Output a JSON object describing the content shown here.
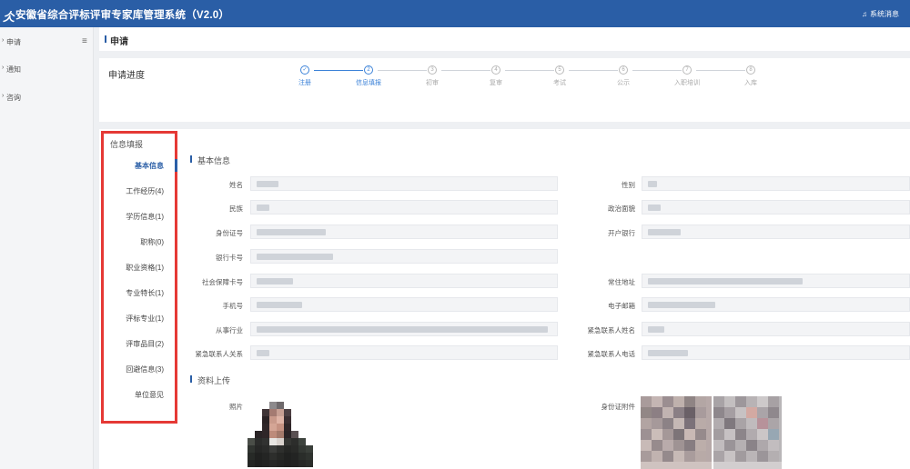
{
  "header": {
    "logo_glyph": "仌",
    "title": "安徽省综合评标评审专家库管理系统（V2.0）",
    "system_message": "系统消息",
    "bell_icon": "bell-icon"
  },
  "sidebar": {
    "items": [
      {
        "label": "申请",
        "icon": "apply-icon"
      },
      {
        "label": "通知",
        "icon": "notice-icon"
      },
      {
        "label": "咨询",
        "icon": "consult-icon"
      }
    ],
    "menu_icon": "hamburger-icon"
  },
  "page": {
    "title": "申请"
  },
  "progress": {
    "title": "申请进度",
    "steps": [
      {
        "num": "✓",
        "label": "注册",
        "state": "done"
      },
      {
        "num": "2",
        "label": "信息填报",
        "state": "active"
      },
      {
        "num": "3",
        "label": "初审",
        "state": "todo"
      },
      {
        "num": "4",
        "label": "复审",
        "state": "todo"
      },
      {
        "num": "5",
        "label": "考试",
        "state": "todo"
      },
      {
        "num": "6",
        "label": "公示",
        "state": "todo"
      },
      {
        "num": "7",
        "label": "入职培训",
        "state": "todo"
      },
      {
        "num": "8",
        "label": "入库",
        "state": "todo"
      }
    ]
  },
  "form_nav": {
    "head": "信息填报",
    "items": [
      {
        "label": "基本信息",
        "active": true
      },
      {
        "label": "工作经历(4)",
        "active": false
      },
      {
        "label": "学历信息(1)",
        "active": false
      },
      {
        "label": "职称(0)",
        "active": false
      },
      {
        "label": "职业资格(1)",
        "active": false
      },
      {
        "label": "专业特长(1)",
        "active": false
      },
      {
        "label": "评标专业(1)",
        "active": false
      },
      {
        "label": "评审品目(2)",
        "active": false
      },
      {
        "label": "回避信息(3)",
        "active": false
      },
      {
        "label": "单位意见",
        "active": false
      }
    ]
  },
  "basic_info": {
    "section_title": "基本信息",
    "left_fields": [
      "姓名",
      "民族",
      "身份证号",
      "银行卡号",
      "社会保障卡号",
      "手机号",
      "从事行业",
      "紧急联系人关系"
    ],
    "right_fields": [
      "性别",
      "政治面貌",
      "开户银行",
      "",
      "常住地址",
      "电子邮箱",
      "紧急联系人姓名",
      "紧急联系人电话"
    ]
  },
  "upload": {
    "section_title": "资料上传",
    "photo_label": "照片",
    "id_label": "身份证附件"
  }
}
